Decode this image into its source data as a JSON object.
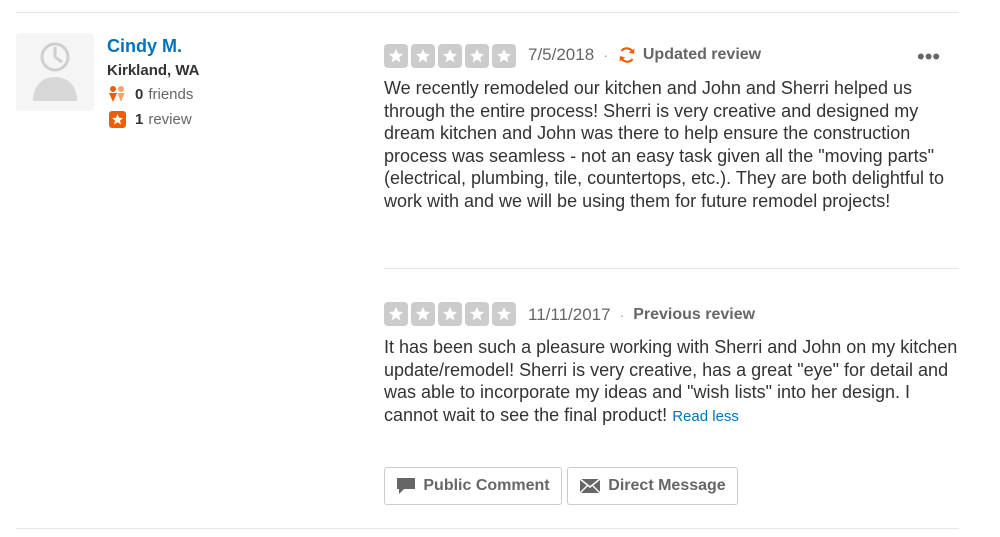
{
  "user": {
    "name": "Cindy M.",
    "location": "Kirkland, WA",
    "friends_count": "0",
    "friends_label": "friends",
    "reviews_count": "1",
    "reviews_label": "review"
  },
  "current_review": {
    "rating": 5,
    "date": "7/5/2018",
    "separator": "·",
    "tag": "Updated review",
    "text": "We recently remodeled our kitchen and John and Sherri helped us through the entire process!  Sherri is very creative and designed my dream kitchen and John was there to help ensure the construction process was seamless - not an easy task given all the \"moving parts\" (electrical, plumbing, tile, countertops, etc.).  They are both delightful to work with and we will be using them for future remodel projects!"
  },
  "previous_review": {
    "rating": 5,
    "date": "11/11/2017",
    "separator": "·",
    "tag": "Previous review",
    "text": "It has been such a pleasure working with Sherri and John on my kitchen update/remodel!  Sherri is very creative, has a great \"eye\" for detail and was able to incorporate my ideas and \"wish lists\" into her design.  I cannot wait to see the final product!",
    "read_less": "Read less"
  },
  "more_menu": "•••",
  "actions": {
    "public_comment": "Public Comment",
    "direct_message": "Direct Message"
  },
  "colors": {
    "link": "#0073bb",
    "accent": "#f15c00",
    "star_grey": "#cccccc",
    "border": "#e6e6e6"
  },
  "icons": {
    "avatar": "default-user-icon",
    "friends": "friends-icon",
    "reviews": "review-star-icon",
    "updated": "refresh-icon",
    "comment": "speech-bubble-icon",
    "message": "envelope-icon"
  }
}
